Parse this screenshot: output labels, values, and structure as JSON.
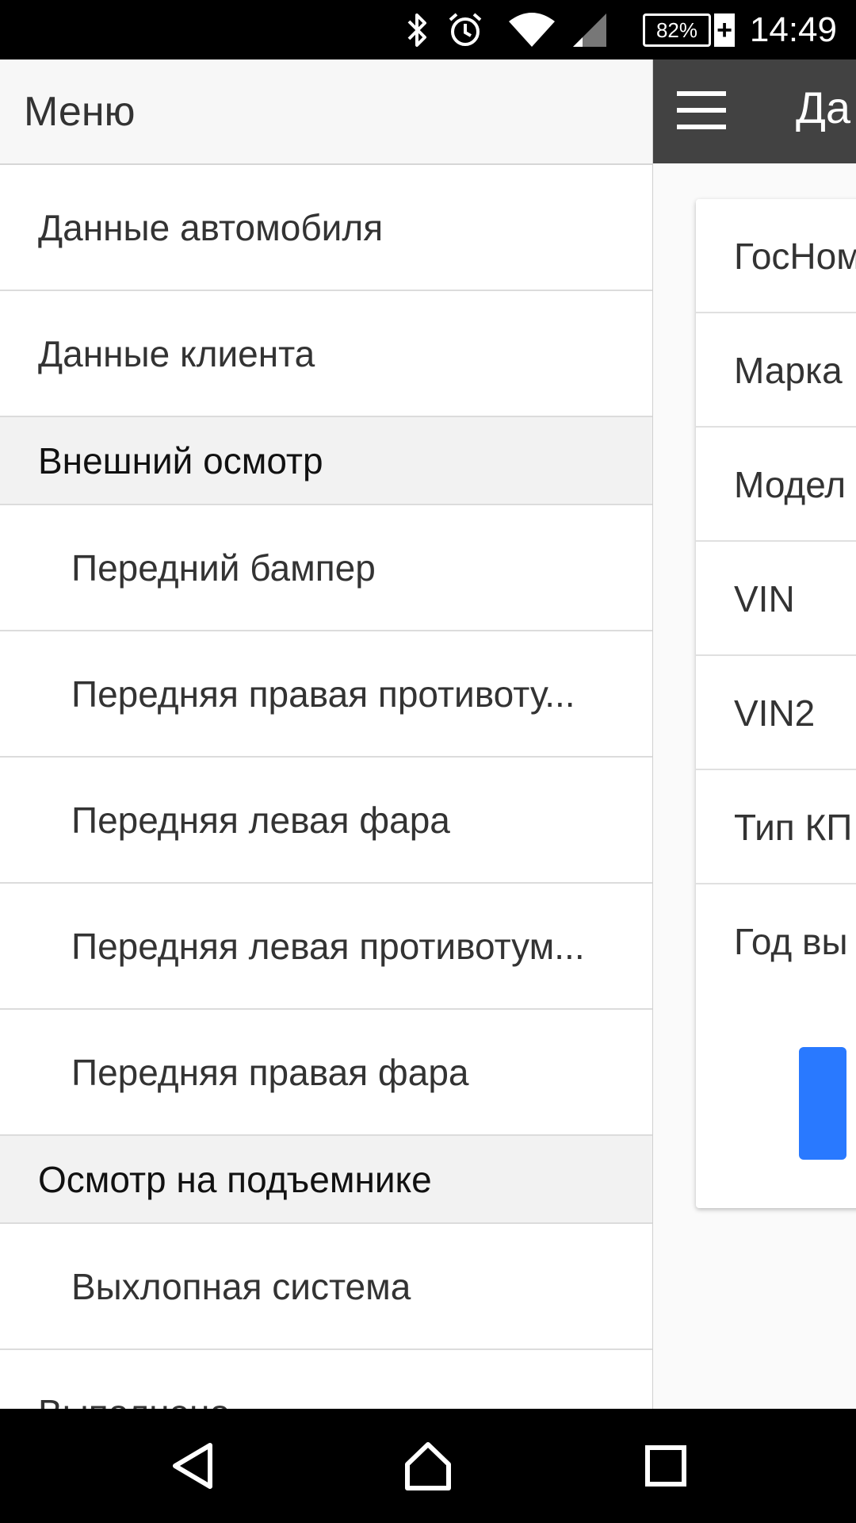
{
  "status_bar": {
    "battery": "82%",
    "time": "14:49",
    "icons": [
      "bluetooth-icon",
      "alarm-icon",
      "wifi-icon",
      "cell-signal-icon",
      "battery-icon"
    ]
  },
  "app": {
    "toolbar_title": "Да",
    "fields": [
      "ГосНом",
      "Марка",
      "Модел",
      "VIN",
      "VIN2",
      "Тип КП",
      "Год вы"
    ]
  },
  "drawer": {
    "title": "Меню",
    "items": [
      {
        "label": "Данные автомобиля"
      },
      {
        "label": "Данные клиента"
      },
      {
        "section": "Внешний осмотр"
      },
      {
        "label": "Передний бампер"
      },
      {
        "label": "Передняя правая противоту..."
      },
      {
        "label": "Передняя левая фара"
      },
      {
        "label": "Передняя левая противотум..."
      },
      {
        "label": "Передняя правая фара"
      },
      {
        "section": "Осмотр на подъемнике"
      },
      {
        "label": "Выхлопная система"
      },
      {
        "label": "Выполнено"
      }
    ]
  },
  "nav_bar": {
    "icons": [
      "back-icon",
      "home-icon",
      "recent-apps-icon"
    ]
  }
}
